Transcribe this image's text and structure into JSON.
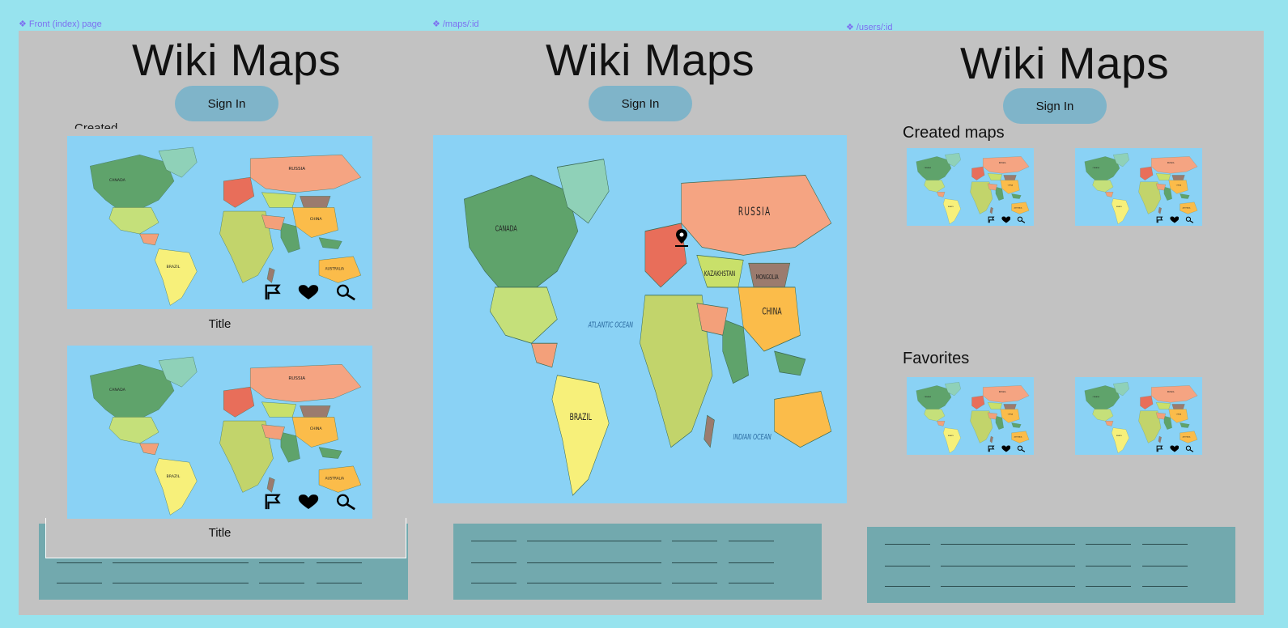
{
  "frames": {
    "index": {
      "label": "Front (index) page"
    },
    "map": {
      "label": "/maps/:id"
    },
    "user": {
      "label": "/users/:id"
    }
  },
  "app": {
    "title": "Wiki Maps",
    "signin_label": "Sign In"
  },
  "index_page": {
    "partial_heading": "Created",
    "cards": [
      {
        "title": "Title"
      },
      {
        "title": "Title"
      }
    ]
  },
  "user_page": {
    "created_heading": "Created maps",
    "favorites_heading": "Favorites"
  },
  "map_labels": {
    "russia": "RUSSIA",
    "canada": "CANADA",
    "china": "CHINA",
    "brazil": "BRAZIL",
    "kazakhstan": "KAZAKHSTAN",
    "mongolia": "MONGOLIA",
    "atlantic": "ATLANTIC OCEAN",
    "indian": "INDIAN OCEAN",
    "australia": "AUSTRALIA"
  },
  "icons": [
    "flag-icon",
    "heart-icon",
    "search-icon",
    "map-pin-icon",
    "component-glyph-icon"
  ],
  "colors": {
    "page_bg": "#97e3ee",
    "canvas_bg": "#c2c2c2",
    "button_bg": "#7fb4c9",
    "footer_bg": "#72a9ae",
    "frame_label": "#7c6ff0",
    "ocean": "#8ad2f5"
  }
}
